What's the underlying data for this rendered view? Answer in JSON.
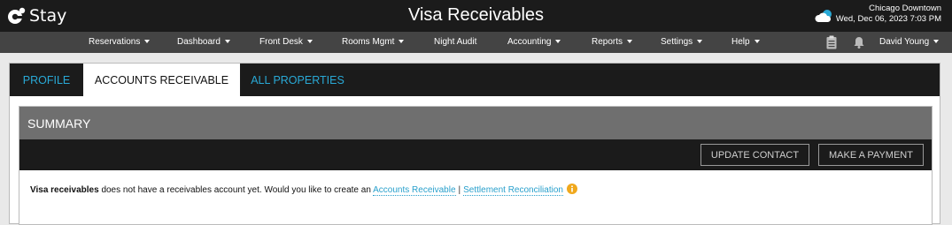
{
  "app": {
    "logo_text": "Stay",
    "title": "Visa Receivables",
    "location": "Chicago Downtown",
    "datetime": "Wed, Dec 06, 2023 7:03 PM"
  },
  "nav": {
    "items": [
      {
        "label": "Reservations",
        "dropdown": true
      },
      {
        "label": "Dashboard",
        "dropdown": true
      },
      {
        "label": "Front Desk",
        "dropdown": true
      },
      {
        "label": "Rooms Mgmt",
        "dropdown": true
      },
      {
        "label": "Night Audit",
        "dropdown": false
      },
      {
        "label": "Accounting",
        "dropdown": true
      },
      {
        "label": "Reports",
        "dropdown": true
      },
      {
        "label": "Settings",
        "dropdown": true
      },
      {
        "label": "Help",
        "dropdown": true
      }
    ],
    "icons": [
      "clipboard-icon",
      "bell-icon"
    ],
    "user": "David Young"
  },
  "tabs": [
    {
      "label": "PROFILE",
      "active": false
    },
    {
      "label": "ACCOUNTS RECEIVABLE",
      "active": true
    },
    {
      "label": "ALL PROPERTIES",
      "active": false
    }
  ],
  "summary": {
    "title": "SUMMARY",
    "buttons": {
      "update_contact": "UPDATE CONTACT",
      "make_payment": "MAKE A PAYMENT"
    },
    "message": {
      "entity": "Visa receivables",
      "text": "does not have a receivables account yet. Would you like to create an",
      "link1": "Accounts Receivable",
      "separator": "|",
      "link2": "Settlement Reconciliation"
    }
  },
  "colors": {
    "topbar": "#1b1b1b",
    "navbar": "#444444",
    "accent_link": "#29a9d6",
    "panel_header": "#6f6f6f",
    "info": "#f0a81c"
  }
}
